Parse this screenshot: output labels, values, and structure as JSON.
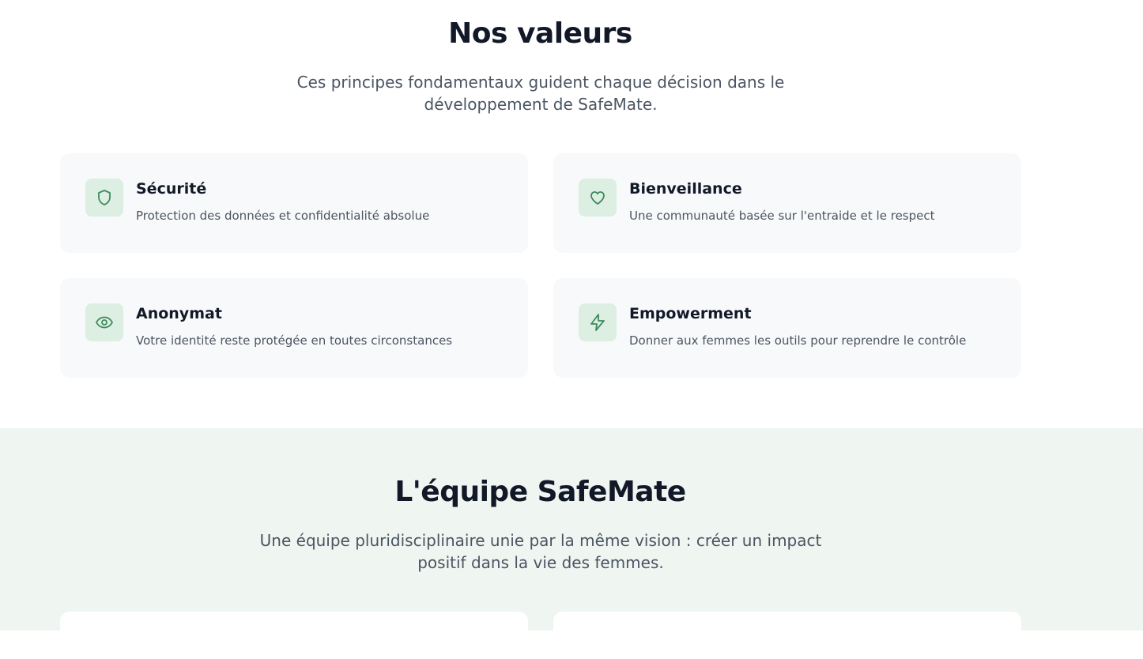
{
  "values": {
    "title": "Nos valeurs",
    "subtitle": "Ces principes fondamentaux guident chaque décision dans le développement de SafeMate.",
    "items": [
      {
        "icon": "shield-icon",
        "title": "Sécurité",
        "description": "Protection des données et confidentialité absolue"
      },
      {
        "icon": "heart-icon",
        "title": "Bienveillance",
        "description": "Une communauté basée sur l'entraide et le respect"
      },
      {
        "icon": "eye-icon",
        "title": "Anonymat",
        "description": "Votre identité reste protégée en toutes circonstances"
      },
      {
        "icon": "lightning-icon",
        "title": "Empowerment",
        "description": "Donner aux femmes les outils pour reprendre le contrôle"
      }
    ]
  },
  "team": {
    "title": "L'équipe SafeMate",
    "subtitle": "Une équipe pluridisciplinaire unie par la même vision : créer un impact positif dans la vie des femmes."
  },
  "colors": {
    "accent": "#3f8a5c",
    "icon_bg": "#dcefe2",
    "card_bg": "#f8f9fa",
    "team_bg": "#eff5f0",
    "heading": "#111827",
    "body_text": "#4b5563"
  }
}
